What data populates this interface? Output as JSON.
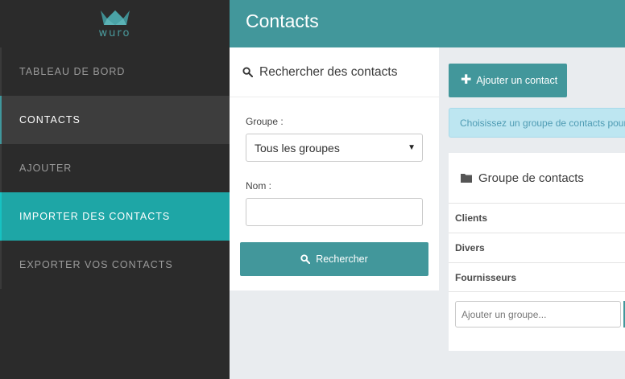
{
  "brand": {
    "name": "wuro"
  },
  "sidebar": {
    "items": [
      {
        "label": "TABLEAU DE BORD"
      },
      {
        "label": "CONTACTS"
      },
      {
        "label": "AJOUTER"
      },
      {
        "label": "IMPORTER DES CONTACTS"
      },
      {
        "label": "EXPORTER VOS CONTACTS"
      }
    ]
  },
  "header": {
    "title": "Contacts"
  },
  "search": {
    "title": "Rechercher des contacts",
    "group_label": "Groupe :",
    "group_selected": "Tous les groupes",
    "name_label": "Nom :",
    "name_value": "",
    "button_label": "Rechercher"
  },
  "actions": {
    "add_contact_label": "Ajouter un contact"
  },
  "info": {
    "text": "Choisissez un groupe de contacts pour"
  },
  "groups": {
    "title": "Groupe de contacts",
    "items": [
      {
        "label": "Clients"
      },
      {
        "label": "Divers"
      },
      {
        "label": "Fournisseurs"
      }
    ],
    "add_placeholder": "Ajouter un groupe..."
  },
  "colors": {
    "accent": "#42979b",
    "sidebar_bg": "#2b2b2b",
    "highlight": "#1ea6a6",
    "info_bg": "#bde6f1"
  }
}
